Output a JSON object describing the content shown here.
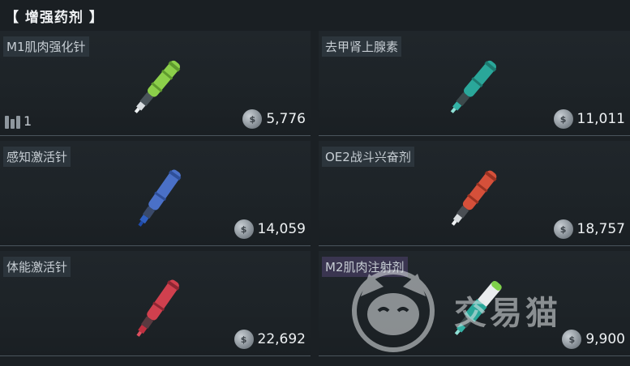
{
  "header": {
    "title": "【 增强药剂 】"
  },
  "items": [
    {
      "name": "M1肌肉强化针",
      "price": "5,776",
      "count": "1",
      "color": "#8ccf4a",
      "tag_color": "purple_off"
    },
    {
      "name": "去甲肾上腺素",
      "price": "11,011",
      "color": "#2aa79a"
    },
    {
      "name": "感知激活针",
      "price": "14,059",
      "color": "#4a70c7"
    },
    {
      "name": "OE2战斗兴奋剂",
      "price": "18,757",
      "color": "#d5503a"
    },
    {
      "name": "体能激活针",
      "price": "22,692",
      "color": "#d0404e"
    },
    {
      "name": "M2肌肉注射剂",
      "price": "9,900",
      "color": "#2aa79a"
    }
  ],
  "currency_icon": "coin-icon",
  "watermark": {
    "text": "交易猫"
  }
}
